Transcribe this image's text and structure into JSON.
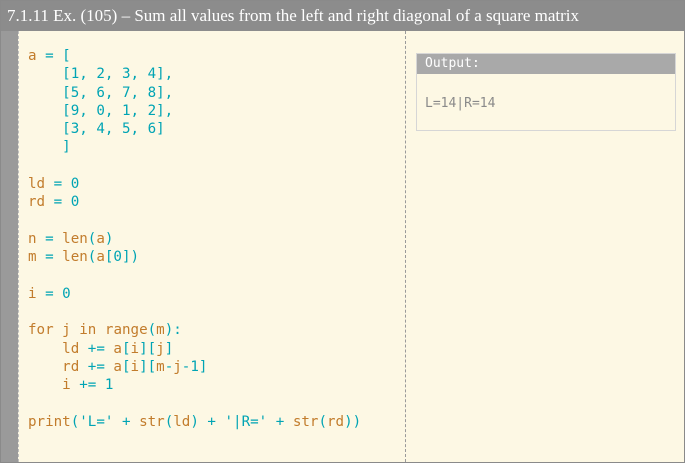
{
  "title": "7.1.11 Ex. (105) – Sum all values from the left and right diagonal of a square matrix",
  "code_lines": [
    [
      [
        "a",
        "id"
      ],
      [
        " = [",
        "op"
      ]
    ],
    [
      [
        "    [1, 2, 3, 4],",
        "num"
      ]
    ],
    [
      [
        "    [5, 6, 7, 8],",
        "num"
      ]
    ],
    [
      [
        "    [9, 0, 1, 2],",
        "num"
      ]
    ],
    [
      [
        "    [3, 4, 5, 6]",
        "num"
      ]
    ],
    [
      [
        "    ]",
        "op"
      ]
    ],
    [],
    [
      [
        "ld",
        "id"
      ],
      [
        " = 0",
        "num"
      ]
    ],
    [
      [
        "rd",
        "id"
      ],
      [
        " = 0",
        "num"
      ]
    ],
    [],
    [
      [
        "n",
        "id"
      ],
      [
        " = ",
        "op"
      ],
      [
        "len",
        "id"
      ],
      [
        "(",
        "op"
      ],
      [
        "a",
        "id"
      ],
      [
        ")",
        "op"
      ]
    ],
    [
      [
        "m",
        "id"
      ],
      [
        " = ",
        "op"
      ],
      [
        "len",
        "id"
      ],
      [
        "(",
        "op"
      ],
      [
        "a",
        "id"
      ],
      [
        "[0])",
        "num"
      ]
    ],
    [],
    [
      [
        "i",
        "id"
      ],
      [
        " = 0",
        "num"
      ]
    ],
    [],
    [
      [
        "for",
        "kw"
      ],
      [
        " ",
        "op"
      ],
      [
        "j",
        "id"
      ],
      [
        " ",
        "op"
      ],
      [
        "in",
        "kw"
      ],
      [
        " ",
        "op"
      ],
      [
        "range",
        "id"
      ],
      [
        "(",
        "op"
      ],
      [
        "m",
        "id"
      ],
      [
        "):",
        "op"
      ]
    ],
    [
      [
        "    ld",
        "id"
      ],
      [
        " += ",
        "op"
      ],
      [
        "a",
        "id"
      ],
      [
        "[",
        "op"
      ],
      [
        "i",
        "id"
      ],
      [
        "][",
        "op"
      ],
      [
        "j",
        "id"
      ],
      [
        "]",
        "op"
      ]
    ],
    [
      [
        "    rd",
        "id"
      ],
      [
        " += ",
        "op"
      ],
      [
        "a",
        "id"
      ],
      [
        "[",
        "op"
      ],
      [
        "i",
        "id"
      ],
      [
        "][",
        "op"
      ],
      [
        "m",
        "id"
      ],
      [
        "-",
        "op"
      ],
      [
        "j",
        "id"
      ],
      [
        "-1]",
        "num"
      ]
    ],
    [
      [
        "    i",
        "id"
      ],
      [
        " += 1",
        "num"
      ]
    ],
    [],
    [
      [
        "print",
        "id"
      ],
      [
        "('L=' + ",
        "str"
      ],
      [
        "str",
        "id"
      ],
      [
        "(",
        "op"
      ],
      [
        "ld",
        "id"
      ],
      [
        ") + '|R=' + ",
        "str"
      ],
      [
        "str",
        "id"
      ],
      [
        "(",
        "op"
      ],
      [
        "rd",
        "id"
      ],
      [
        "))",
        "op"
      ]
    ]
  ],
  "output": {
    "label": "Output:",
    "text": "L=14|R=14"
  },
  "colors": {
    "title_bar": "#8c8c8c",
    "panel_bg": "#fdf8e4",
    "keyword": "#c27c2c",
    "literal": "#00a4b4",
    "output_text": "#8a8a8a"
  }
}
